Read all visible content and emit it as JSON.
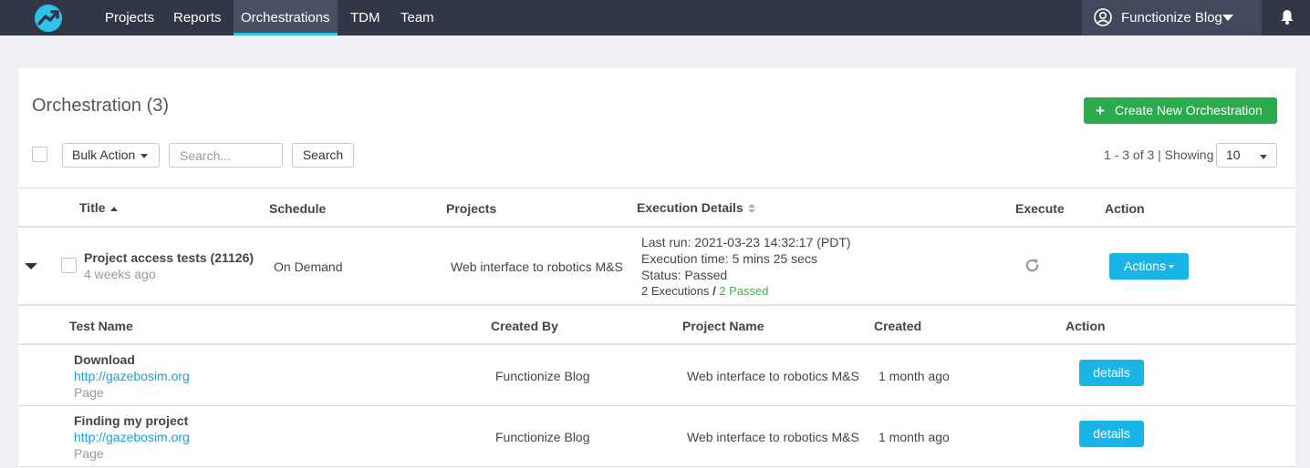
{
  "nav": {
    "items": [
      {
        "label": "Projects",
        "active": false
      },
      {
        "label": "Reports",
        "active": false
      },
      {
        "label": "Orchestrations",
        "active": true
      },
      {
        "label": "TDM",
        "active": false
      },
      {
        "label": "Team",
        "active": false
      }
    ],
    "user_name": "Functionize Blog",
    "icons": {
      "user": "user-circle-icon",
      "notifications": "bell-icon",
      "logo": "functionize-logo"
    }
  },
  "page": {
    "title": "Orchestration (3)",
    "create_button": "Create New Orchestration",
    "bulk_action": "Bulk Action",
    "search_placeholder": "Search...",
    "search_button": "Search",
    "pagination": "1 - 3 of 3 | Showing",
    "showing_value": "10"
  },
  "table": {
    "headers": {
      "title": "Title",
      "schedule": "Schedule",
      "projects": "Projects",
      "execution_details": "Execution Details",
      "execute": "Execute",
      "action": "Action"
    },
    "rows": [
      {
        "title": "Project access tests (21126)",
        "age": "4 weeks ago",
        "schedule": "On Demand",
        "project": "Web interface to robotics M&S",
        "last_run": "Last run: 2021-03-23 14:32:17 (PDT)",
        "execution_time": "Execution time: 5 mins 25 secs",
        "status": "Status: Passed",
        "executions": "2 Executions",
        "separator": "/",
        "passed": "2 Passed",
        "actions_label": "Actions",
        "expanded": true
      }
    ]
  },
  "subtable": {
    "headers": {
      "test_name": "Test Name",
      "created_by": "Created By",
      "project_name": "Project Name",
      "created": "Created",
      "action": "Action"
    },
    "rows": [
      {
        "name": "Download",
        "url": "http://gazebosim.org",
        "type": "Page",
        "created_by": "Functionize Blog",
        "project_name": "Web interface to robotics M&S",
        "created": "1 month ago",
        "action": "details"
      },
      {
        "name": "Finding my project",
        "url": "http://gazebosim.org",
        "type": "Page",
        "created_by": "Functionize Blog",
        "project_name": "Web interface to robotics M&S",
        "created": "1 month ago",
        "action": "details"
      }
    ]
  },
  "colors": {
    "nav_bg": "#323748",
    "accent": "#1ab4e6",
    "create_green": "#2eaa4e",
    "passed_green": "#3bb54a",
    "link": "#1a9fd6"
  }
}
